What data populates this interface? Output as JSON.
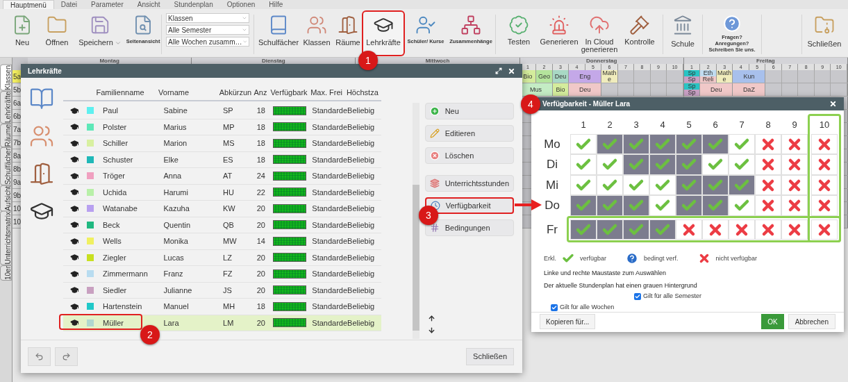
{
  "menu_tabs": [
    {
      "label": "Hauptmenü",
      "selected": true
    },
    {
      "label": "Datei",
      "selected": false
    },
    {
      "label": "Parameter",
      "selected": false
    },
    {
      "label": "Ansicht",
      "selected": false
    },
    {
      "label": "Stundenplan",
      "selected": false
    },
    {
      "label": "Optionen",
      "selected": false
    },
    {
      "label": "Hilfe",
      "selected": false
    }
  ],
  "toolbar": {
    "file": [
      {
        "label": "Neu",
        "kind": "regular",
        "dropdown": false
      },
      {
        "label": "Öffnen",
        "kind": "regular",
        "dropdown": false
      },
      {
        "label": "Speichern",
        "kind": "regular",
        "dropdown": true
      },
      {
        "label": "Seitenansicht",
        "kind": "compact",
        "dropdown": false
      }
    ],
    "filters": [
      "Klassen",
      "Alle Semester",
      "Alle Wochen zusamm…"
    ],
    "data": [
      {
        "label": "Schulfächer",
        "kind": "regular",
        "annotated": false
      },
      {
        "label": "Klassen",
        "kind": "regular",
        "annotated": false
      },
      {
        "label": "Räume",
        "kind": "regular",
        "annotated": false
      },
      {
        "label": "Lehrkräfte",
        "kind": "regular",
        "annotated": true
      },
      {
        "label": "Schüler/ Kurse",
        "kind": "compact",
        "annotated": false
      },
      {
        "label": "Zusammenhänge",
        "kind": "compact",
        "annotated": false
      }
    ],
    "generate": [
      {
        "label": "Testen"
      },
      {
        "label": "Generieren"
      },
      {
        "label": "In Cloud generieren"
      },
      {
        "label": "Kontrolle"
      }
    ],
    "school": {
      "label": "Schule"
    },
    "feedback": {
      "lines": [
        "Fragen?",
        "Anregungen?",
        "Schreiben Sie uns."
      ]
    },
    "close": {
      "label": "Schließen"
    }
  },
  "side_tabs": [
    {
      "label": "Klassen",
      "selected": true
    },
    {
      "label": "Lehrkräfte",
      "selected": false
    },
    {
      "label": "Räume",
      "selected": false
    },
    {
      "label": "Schulfächer",
      "selected": false
    },
    {
      "label": "Aufsicht",
      "selected": false
    },
    {
      "label": "Unterrichtsmatrix",
      "selected": false
    },
    {
      "label": "10er",
      "selected": false
    }
  ],
  "timetable": {
    "days": [
      {
        "name": "Montag"
      },
      {
        "name": "Dienstag"
      },
      {
        "name": "Mittwoch"
      },
      {
        "name": "Donnerstag",
        "periods": [
          "1",
          "2",
          "3",
          "4",
          "5",
          "6",
          "7",
          "8",
          "9",
          "10"
        ]
      },
      {
        "name": "Freitag",
        "periods": [
          "1",
          "2",
          "3",
          "4",
          "5",
          "6",
          "7",
          "8",
          "9",
          "10"
        ]
      }
    ],
    "rows": [
      {
        "label": "5a",
        "selected": true,
        "schedule": [
          [
            {
              "kind": "lesson",
              "parts": [
                {
                  "text": "Bio",
                  "color": "#d4ec9c"
                }
              ]
            },
            {
              "kind": "lesson",
              "parts": [
                {
                  "text": "Geo",
                  "color": "#b4e49c"
                }
              ]
            },
            {
              "kind": "lesson",
              "parts": [
                {
                  "text": "Deu",
                  "color": "#a8d8c4"
                }
              ]
            },
            {
              "kind": "lesson",
              "parts": [
                {
                  "text": "Eng",
                  "color": "#c4a8e8"
                }
              ]
            },
            {
              "kind": "continued"
            },
            {
              "kind": "lesson",
              "parts": [
                {
                  "text": "Mathe",
                  "color": "#f0ecbc"
                }
              ]
            },
            {
              "kind": "empty"
            },
            {
              "kind": "empty"
            },
            {
              "kind": "empty"
            },
            {
              "kind": "empty"
            }
          ],
          [
            {
              "kind": "lesson",
              "parts": [
                {
                  "text": "Sp",
                  "color": "#28c4c4"
                },
                {
                  "text": "Sp",
                  "color": "#c8a0c4"
                }
              ]
            },
            {
              "kind": "lesson",
              "parts": [
                {
                  "text": "Eth",
                  "color": "#c0dcf0"
                },
                {
                  "text": "Reli",
                  "color": "#f0c8c8"
                }
              ]
            },
            {
              "kind": "lesson",
              "parts": [
                {
                  "text": "Mathe",
                  "color": "#f0ecbc"
                }
              ]
            },
            {
              "kind": "lesson",
              "parts": [
                {
                  "text": "Kun",
                  "color": "#a8c0ec"
                }
              ]
            },
            {
              "kind": "continued"
            },
            {
              "kind": "empty"
            },
            {
              "kind": "empty"
            },
            {
              "kind": "empty"
            },
            {
              "kind": "empty"
            },
            {
              "kind": "empty"
            }
          ]
        ]
      },
      {
        "label": "5b",
        "selected": false,
        "schedule": [
          [
            {
              "kind": "lesson",
              "parts": [
                {
                  "text": "Mus",
                  "color": "#c4ecc4"
                }
              ]
            },
            {
              "kind": "continued"
            },
            {
              "kind": "lesson",
              "parts": [
                {
                  "text": "Bio",
                  "color": "#d4ec9c"
                }
              ]
            },
            {
              "kind": "lesson",
              "parts": [
                {
                  "text": "Deu",
                  "color": "#f0c8c8"
                }
              ]
            },
            {
              "kind": "continued"
            },
            {
              "kind": "empty"
            },
            {
              "kind": "empty"
            },
            {
              "kind": "empty"
            },
            {
              "kind": "empty"
            },
            {
              "kind": "empty"
            }
          ],
          [
            {
              "kind": "lesson",
              "parts": [
                {
                  "text": "Sp",
                  "color": "#28c4c4"
                },
                {
                  "text": "Sp",
                  "color": "#c8a0c4"
                }
              ]
            },
            {
              "kind": "lesson",
              "parts": [
                {
                  "text": "Deu",
                  "color": "#f0c8c8"
                }
              ]
            },
            {
              "kind": "continued"
            },
            {
              "kind": "lesson",
              "parts": [
                {
                  "text": "DaZ",
                  "color": "#f0c8c8"
                }
              ]
            },
            {
              "kind": "continued"
            },
            {
              "kind": "empty"
            },
            {
              "kind": "empty"
            },
            {
              "kind": "empty"
            },
            {
              "kind": "empty"
            },
            {
              "kind": "empty"
            }
          ]
        ]
      },
      {
        "label": "6a",
        "selected": false
      },
      {
        "label": "6b",
        "selected": false
      },
      {
        "label": "7a",
        "selected": false
      },
      {
        "label": "7b",
        "selected": false
      },
      {
        "label": "8a",
        "selected": false
      },
      {
        "label": "8b",
        "selected": false
      },
      {
        "label": "9a",
        "selected": false
      },
      {
        "label": "9b",
        "selected": false
      },
      {
        "label": "10",
        "selected": false
      },
      {
        "label": "10",
        "selected": false
      }
    ]
  },
  "teachers_dialog": {
    "title": "Lehrkräfte",
    "columns": [
      "Familienname",
      "Vorname",
      "Abkürzun",
      "Anz",
      "Verfügbark",
      "Max. Frei",
      "Höchstza"
    ],
    "rows": [
      {
        "surname": "Paul",
        "first_name": "Sabine",
        "abbreviation": "SP",
        "count": "18",
        "max_free": "Standarde",
        "max_hours": "Beliebig",
        "color": "#5ef0f0",
        "selected": false,
        "annotated": false
      },
      {
        "surname": "Polster",
        "first_name": "Marius",
        "abbreviation": "MP",
        "count": "18",
        "max_free": "Standarde",
        "max_hours": "Beliebig",
        "color": "#5ee8b8",
        "selected": false,
        "annotated": false
      },
      {
        "surname": "Schiller",
        "first_name": "Marion",
        "abbreviation": "MS",
        "count": "18",
        "max_free": "Standarde",
        "max_hours": "Beliebig",
        "color": "#d8f0a0",
        "selected": false,
        "annotated": false
      },
      {
        "surname": "Schuster",
        "first_name": "Elke",
        "abbreviation": "ES",
        "count": "18",
        "max_free": "Standarde",
        "max_hours": "Beliebig",
        "color": "#20b8b8",
        "selected": false,
        "annotated": false
      },
      {
        "surname": "Tröger",
        "first_name": "Anna",
        "abbreviation": "AT",
        "count": "24",
        "max_free": "Standarde",
        "max_hours": "Beliebig",
        "color": "#f0a0c0",
        "selected": false,
        "annotated": false
      },
      {
        "surname": "Uchida",
        "first_name": "Harumi",
        "abbreviation": "HU",
        "count": "22",
        "max_free": "Standarde",
        "max_hours": "Beliebig",
        "color": "#b8f0a8",
        "selected": false,
        "annotated": false
      },
      {
        "surname": "Watanabe",
        "first_name": "Kazuha",
        "abbreviation": "KW",
        "count": "20",
        "max_free": "Standarde",
        "max_hours": "Beliebig",
        "color": "#b8a0f0",
        "selected": false,
        "annotated": false
      },
      {
        "surname": "Beck",
        "first_name": "Quentin",
        "abbreviation": "QB",
        "count": "20",
        "max_free": "Standarde",
        "max_hours": "Beliebig",
        "color": "#20b880",
        "selected": false,
        "annotated": false
      },
      {
        "surname": "Wells",
        "first_name": "Monika",
        "abbreviation": "MW",
        "count": "14",
        "max_free": "Standarde",
        "max_hours": "Beliebig",
        "color": "#f0f060",
        "selected": false,
        "annotated": false
      },
      {
        "surname": "Ziegler",
        "first_name": "Lucas",
        "abbreviation": "LZ",
        "count": "20",
        "max_free": "Standarde",
        "max_hours": "Beliebig",
        "color": "#c8e020",
        "selected": false,
        "annotated": false
      },
      {
        "surname": "Zimmermann",
        "first_name": "Franz",
        "abbreviation": "FZ",
        "count": "20",
        "max_free": "Standarde",
        "max_hours": "Beliebig",
        "color": "#b8dcf0",
        "selected": false,
        "annotated": false
      },
      {
        "surname": "Siedler",
        "first_name": "Julianne",
        "abbreviation": "JS",
        "count": "20",
        "max_free": "Standarde",
        "max_hours": "Beliebig",
        "color": "#c8a0c0",
        "selected": false,
        "annotated": false
      },
      {
        "surname": "Hartenstein",
        "first_name": "Manuel",
        "abbreviation": "MH",
        "count": "18",
        "max_free": "Standarde",
        "max_hours": "Beliebig",
        "color": "#20c8c8",
        "selected": false,
        "annotated": false
      },
      {
        "surname": "Müller",
        "first_name": "Lara",
        "abbreviation": "LM",
        "count": "20",
        "max_free": "Standarde",
        "max_hours": "Beliebig",
        "color": "#b0d8d0",
        "selected": true,
        "annotated": true
      }
    ],
    "actions": [
      {
        "label": "Neu",
        "annotated": false
      },
      {
        "label": "Editieren",
        "annotated": false
      },
      {
        "label": "Löschen",
        "annotated": false
      },
      {
        "label": "Unterrichtsstunden",
        "annotated": false
      },
      {
        "label": "Verfügbarkeit",
        "annotated": true
      },
      {
        "label": "Bedingungen",
        "annotated": false
      }
    ],
    "close_button": "Schließen"
  },
  "availability_dialog": {
    "title": "Verfügbarkeit - Müller Lara",
    "periods": [
      "1",
      "2",
      "3",
      "4",
      "5",
      "6",
      "7",
      "8",
      "9",
      "10"
    ],
    "days": [
      {
        "label": "Mo",
        "cells": [
          {
            "available": true,
            "current": false
          },
          {
            "available": true,
            "current": true
          },
          {
            "available": true,
            "current": true
          },
          {
            "available": true,
            "current": true
          },
          {
            "available": true,
            "current": true
          },
          {
            "available": true,
            "current": true
          },
          {
            "available": true,
            "current": false
          },
          {
            "available": false,
            "current": false
          },
          {
            "available": false,
            "current": false
          },
          {
            "available": false,
            "current": false
          }
        ]
      },
      {
        "label": "Di",
        "cells": [
          {
            "available": true,
            "current": false
          },
          {
            "available": true,
            "current": false
          },
          {
            "available": true,
            "current": true
          },
          {
            "available": true,
            "current": true
          },
          {
            "available": true,
            "current": true
          },
          {
            "available": true,
            "current": false
          },
          {
            "available": true,
            "current": false
          },
          {
            "available": false,
            "current": false
          },
          {
            "available": false,
            "current": false
          },
          {
            "available": false,
            "current": false
          }
        ]
      },
      {
        "label": "Mi",
        "cells": [
          {
            "available": true,
            "current": false
          },
          {
            "available": true,
            "current": false
          },
          {
            "available": true,
            "current": false
          },
          {
            "available": true,
            "current": false
          },
          {
            "available": true,
            "current": true
          },
          {
            "available": true,
            "current": true
          },
          {
            "available": true,
            "current": true
          },
          {
            "available": false,
            "current": false
          },
          {
            "available": false,
            "current": false
          },
          {
            "available": false,
            "current": false
          }
        ]
      },
      {
        "label": "Do",
        "cells": [
          {
            "available": true,
            "current": true
          },
          {
            "available": true,
            "current": true
          },
          {
            "available": true,
            "current": true
          },
          {
            "available": true,
            "current": false
          },
          {
            "available": true,
            "current": true
          },
          {
            "available": true,
            "current": true
          },
          {
            "available": true,
            "current": false
          },
          {
            "available": false,
            "current": false
          },
          {
            "available": false,
            "current": false
          },
          {
            "available": false,
            "current": false
          }
        ]
      },
      {
        "label": "Fr",
        "cells": [
          {
            "available": true,
            "current": true
          },
          {
            "available": true,
            "current": true
          },
          {
            "available": true,
            "current": true
          },
          {
            "available": true,
            "current": true
          },
          {
            "available": false,
            "current": false
          },
          {
            "available": false,
            "current": false
          },
          {
            "available": false,
            "current": false
          },
          {
            "available": false,
            "current": false
          },
          {
            "available": false,
            "current": false
          },
          {
            "available": false,
            "current": false
          }
        ]
      }
    ],
    "legend": {
      "title": "Erkl.",
      "available": "verfügbar",
      "conditional": "bedingt verf.",
      "unavailable": "nicht verfügbar"
    },
    "hint": "Linke und rechte Maustaste zum Auswählen",
    "note": "Der aktuelle Stundenplan hat einen grauen Hintergrund",
    "options": [
      {
        "label": "Gilt für alle Semester",
        "checked": true
      },
      {
        "label": "Gilt für alle Wochen",
        "checked": true
      }
    ],
    "buttons": {
      "copy": "Kopieren für...",
      "ok": "OK",
      "cancel": "Abbrechen"
    }
  },
  "callouts": [
    "1",
    "2",
    "3",
    "4"
  ]
}
